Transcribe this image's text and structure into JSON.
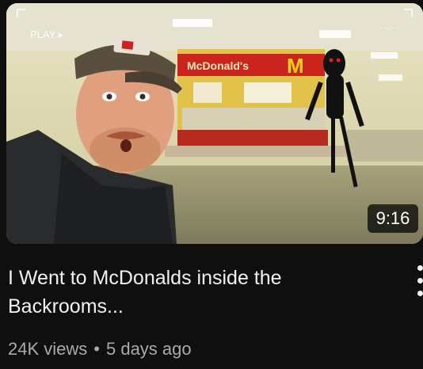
{
  "video": {
    "duration": "9:16",
    "title": "I Went to McDonalds inside the Backrooms...",
    "views": "24K views",
    "separator": "•",
    "age": "5 days ago"
  },
  "thumbnail": {
    "overlay_text": "PLAY ▸",
    "sign_text": "McDonald's",
    "logo_letter": "M"
  },
  "icons": {
    "menu": "more-vert-icon"
  }
}
